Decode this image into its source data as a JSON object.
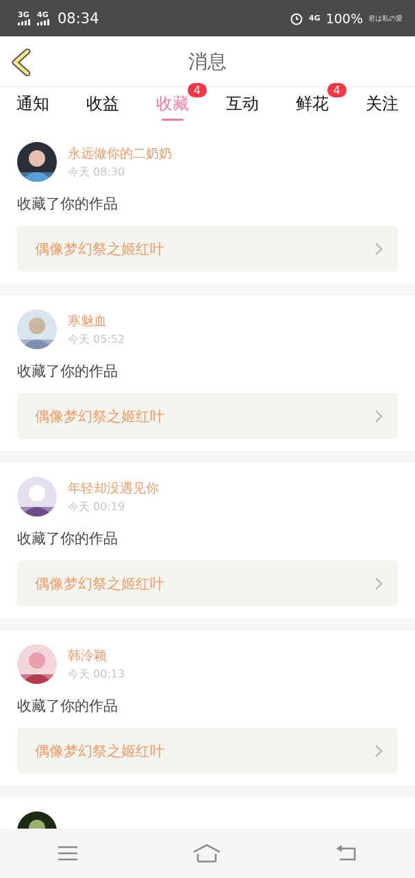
{
  "status_bar": {
    "networks": [
      "3G",
      "4G"
    ],
    "time": "08:34",
    "network_right": "4G",
    "battery": "100%",
    "sticker_text": "君は私の愛"
  },
  "header": {
    "title": "消息"
  },
  "tabs": [
    {
      "label": "通知",
      "selected": false
    },
    {
      "label": "收益",
      "selected": false
    },
    {
      "label": "收藏",
      "selected": true,
      "badge": "4"
    },
    {
      "label": "互动",
      "selected": false
    },
    {
      "label": "鲜花",
      "selected": false,
      "badge": "4"
    },
    {
      "label": "关注",
      "selected": false
    }
  ],
  "items": [
    {
      "avatar": {
        "kind": "picture"
      },
      "name": "永远做你的二奶奶",
      "time": "今天 08:30",
      "action": "收藏了你的作品",
      "work": "偶像梦幻祭之姬红叶"
    },
    {
      "avatar": {
        "kind": "picture"
      },
      "name": "寒魅血",
      "time": "今天 05:52",
      "action": "收藏了你的作品",
      "work": "偶像梦幻祭之姬红叶"
    },
    {
      "avatar": {
        "kind": "picture"
      },
      "name": "年轻却没遇见你",
      "time": "今天 00:19",
      "action": "收藏了你的作品",
      "work": "偶像梦幻祭之姬红叶"
    },
    {
      "avatar": {
        "kind": "picture"
      },
      "name": "韩泠颖",
      "time": "今天 00:13",
      "action": "收藏了你的作品",
      "work": "偶像梦幻祭之姬红叶"
    },
    {
      "avatar": {
        "kind": "picture"
      }
    }
  ]
}
